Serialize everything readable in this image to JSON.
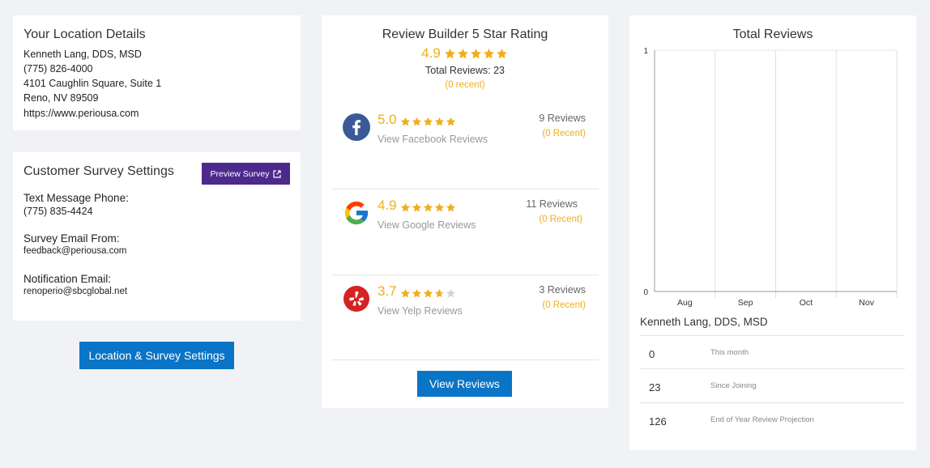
{
  "location": {
    "title": "Your Location Details",
    "name": "Kenneth Lang, DDS, MSD",
    "phone": "(775) 826-4000",
    "address1": "4101 Caughlin Square, Suite 1",
    "address2": "Reno, NV 89509",
    "website": "https://www.periousa.com"
  },
  "survey": {
    "title": "Customer Survey Settings",
    "preview_label": "Preview Survey",
    "sms_label": "Text Message Phone:",
    "sms_value": "(775) 835-4424",
    "email_from_label": "Survey Email From:",
    "email_from_value": "feedback@periousa.com",
    "notify_label": "Notification Email:",
    "notify_value": "renoperio@sbcglobal.net"
  },
  "settings_button": "Location & Survey Settings",
  "review_builder": {
    "title": "Review Builder 5 Star Rating",
    "rating": "4.9",
    "rating_value": 4.9,
    "total": "Total Reviews: 23",
    "recent": "(0 recent)",
    "platforms": [
      {
        "name": "facebook",
        "rating": "5.0",
        "rating_value": 5.0,
        "link": "View Facebook Reviews",
        "count": "9 Reviews",
        "recent": "(0 Recent)"
      },
      {
        "name": "google",
        "rating": "4.9",
        "rating_value": 4.9,
        "link": "View Google Reviews",
        "count": "11 Reviews",
        "recent": "(0 Recent)"
      },
      {
        "name": "yelp",
        "rating": "3.7",
        "rating_value": 3.7,
        "link": "View Yelp Reviews",
        "count": "3 Reviews",
        "recent": "(0 Recent)"
      }
    ],
    "view_button": "View Reviews"
  },
  "total_reviews": {
    "title": "Total Reviews",
    "owner": "Kenneth Lang, DDS, MSD",
    "stats": [
      {
        "value": "0",
        "label": "This month"
      },
      {
        "value": "23",
        "label": "Since Joining"
      },
      {
        "value": "126",
        "label": "End of Year Review Projection"
      }
    ]
  },
  "chart_data": {
    "type": "bar",
    "title": "Total Reviews",
    "categories": [
      "Aug",
      "Sep",
      "Oct",
      "Nov"
    ],
    "values": [
      0,
      0,
      0,
      0
    ],
    "ylim": [
      0,
      1
    ],
    "yticks": [
      "0",
      "1"
    ],
    "xlabel": "",
    "ylabel": "",
    "grid": true
  },
  "colors": {
    "accent_blue": "#0a74c6",
    "preview_purple": "#4b2a8c",
    "star_gold": "#f0ae1b",
    "star_empty": "#d6d6d6",
    "facebook": "#3b5998",
    "yelp": "#d32323"
  }
}
